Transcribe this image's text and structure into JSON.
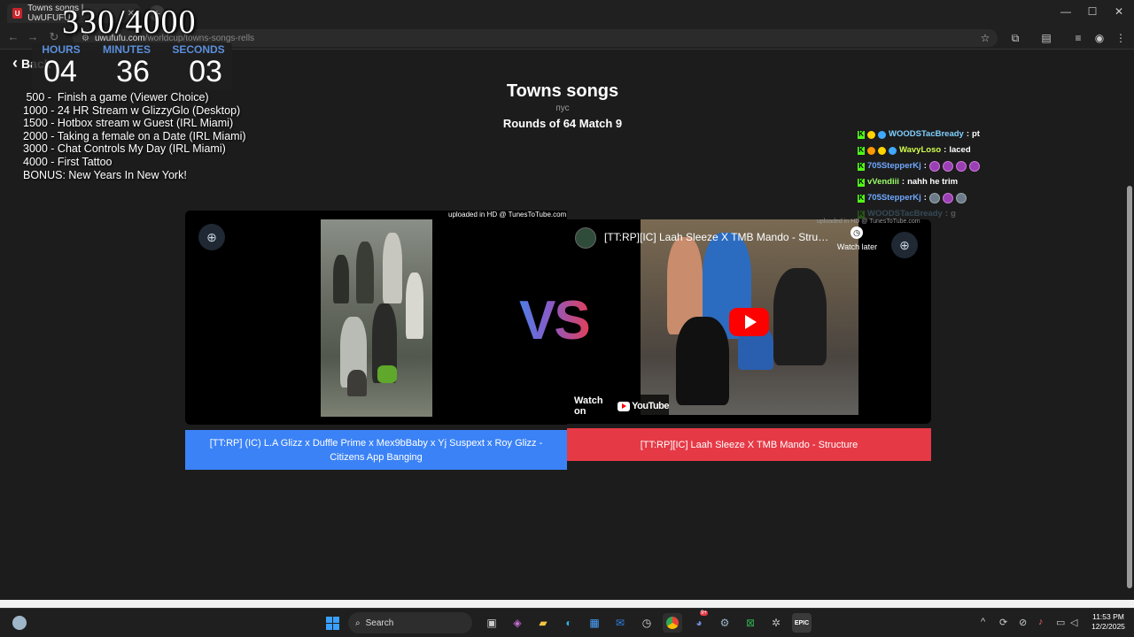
{
  "browser": {
    "tab_title": "Towns songs | UwUFUFU",
    "tab_favicon": "U",
    "url_host": "uwufufu.com",
    "url_path": "/worldcup/towns-songs-rells",
    "new_tab": "+",
    "controls": {
      "minimize": "—",
      "maximize": "☐",
      "close": "✕"
    }
  },
  "overlay": {
    "counter": "330/4000",
    "timer": {
      "hours_label": "HOURS",
      "minutes_label": "MINUTES",
      "seconds_label": "SECONDS",
      "hours": "04",
      "minutes": "36",
      "seconds": "03"
    },
    "goals": [
      " 500 -  Finish a game (Viewer Choice)",
      "1000 - 24 HR Stream w GlizzyGlo (Desktop)",
      "1500 - Hotbox stream w Guest (IRL Miami)",
      "2000 - Taking a female on a Date (IRL Miami)",
      "3000 - Chat Controls My Day (IRL Miami)",
      "4000 - First Tattoo",
      "BONUS: New Years In New York!"
    ]
  },
  "page": {
    "back_label": "Back",
    "title": "Towns songs",
    "subtitle": "пус",
    "round_info": "Rounds of 64 Match 9",
    "vs_label": "VS"
  },
  "chat": [
    {
      "user": "WOODSTacBready",
      "color": "#7fd0ff",
      "message": "pt",
      "emotes": 0,
      "faded": false
    },
    {
      "user": "WavyLoso",
      "color": "#b7ff5a",
      "message": "laced",
      "emotes": 0,
      "faded": false
    },
    {
      "user": "705StepperKj",
      "color": "#6fa8ff",
      "message": "",
      "emotes": 4,
      "faded": false
    },
    {
      "user": "vVendiii",
      "color": "#9cff6a",
      "message": "nahh he trim",
      "emotes": 0,
      "faded": false
    },
    {
      "user": "705StepperKj",
      "color": "#6fa8ff",
      "message": "",
      "emotes": 3,
      "faded": false
    },
    {
      "user": "WOODSTacBready",
      "color": "#7fd0ff",
      "message": "g",
      "emotes": 0,
      "faded": true
    }
  ],
  "left_video": {
    "upload_note": "uploaded in HD @ TunesToTube.com",
    "choice_label": "[TT:RP] (IC) L.A Glizz x Duffle Prime x Mex9bBaby x Yj Suspext x Roy Glizz - Citizens App Banging"
  },
  "right_video": {
    "upload_note": "uploaded in HD @ TunesToTube.com",
    "yt_title": "[TT:RP][IC] Laah Sleeze X TMB Mando - Structure",
    "watch_later": "Watch later",
    "watch_on": "Watch on",
    "youtube": "YouTube",
    "choice_label": "[TT:RP][IC] Laah Sleeze X TMB Mando - Structure"
  },
  "taskbar": {
    "search_placeholder": "Search",
    "time": "11:53 PM",
    "date": "12/2/2025",
    "notification_count": "9+"
  },
  "colors": {
    "accent_blue": "#3b82f6",
    "accent_red": "#e63946",
    "timer_label": "#5b8fdc",
    "kick_green": "#53fc18"
  }
}
